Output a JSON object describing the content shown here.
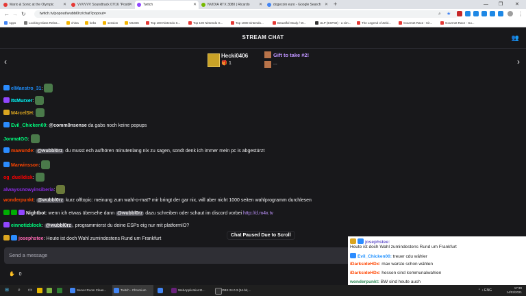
{
  "browser": {
    "tabs": [
      {
        "label": "Mario & Sonic at the Olympic",
        "color": "#e53935"
      },
      {
        "label": "VVVVVV Soundtrack 07/16 \"Positi",
        "color": "#e53935"
      },
      {
        "label": "Twitch",
        "color": "#9146ff"
      },
      {
        "label": "NVIDIA RTX 3080 | Ricardo",
        "color": "#76b900"
      },
      {
        "label": "dogecoin euro - Google Search",
        "color": "#4285f4"
      }
    ],
    "url": "twitch.tv/popout/wubbl0rz/chat?popout=",
    "bookmarks": [
      {
        "label": "Apps",
        "color": "#4285f4"
      },
      {
        "label": "Looking Glass Relea...",
        "color": "#777"
      },
      {
        "label": "china",
        "color": "#f4b400"
      },
      {
        "label": "keks",
        "color": "#f4b400"
      },
      {
        "label": "session",
        "color": "#f4b400"
      },
      {
        "label": "MUSIK",
        "color": "#f4b400"
      },
      {
        "label": "Top 100 Nintendo S...",
        "color": "#e53935"
      },
      {
        "label": "Top 100 Nintendo S...",
        "color": "#e53935"
      },
      {
        "label": "Top 1000 nintendo...",
        "color": "#e53935"
      },
      {
        "label": "Beautiful Study / W...",
        "color": "#e53935"
      },
      {
        "label": "ULP (ESP32) - a sim...",
        "color": "#333"
      },
      {
        "label": "The Legend of Zeld...",
        "color": "#e53935"
      },
      {
        "label": "Gourmet Race - Kir...",
        "color": "#e53935"
      },
      {
        "label": "Gourmet Race - Su...",
        "color": "#e53935"
      }
    ]
  },
  "chat": {
    "header_title": "STREAM CHAT",
    "gift_user": "Hecki0406",
    "gift_count": "1",
    "gift_cta": "Gift to take #2!",
    "gift_more": "...",
    "paused_label": "Chat Paused Due to Scroll",
    "input_placeholder": "Send a message",
    "points": "0",
    "messages": [
      {
        "user": "elMaestro_31",
        "color": "#1e90ff",
        "text": "",
        "mention": "",
        "after": "",
        "link": "",
        "emote": true,
        "badge": "#2b8cff"
      },
      {
        "user": "ItsMurxer",
        "color": "#00ffff",
        "text": "",
        "mention": "",
        "after": "",
        "link": "",
        "emote": true,
        "badge": "#9146ff"
      },
      {
        "user": "M4rcelSH",
        "color": "#daa520",
        "text": "",
        "mention": "",
        "after": "",
        "link": "",
        "emote": true,
        "badge": "#daa520"
      },
      {
        "user": "Evil_Chicken00",
        "color": "#00ff7f",
        "text": "",
        "mention": "@comm0nsense",
        "after": " da gabs noch keine popups",
        "link": "",
        "emote": false,
        "badge": "#2b8cff"
      },
      {
        "user": "JonmatGG",
        "color": "#00ff7f",
        "text": "",
        "mention": "",
        "after": "",
        "link": "",
        "emote": true,
        "badge": ""
      },
      {
        "user": "mawunde",
        "color": "#ff4500",
        "text": " ",
        "mention": "@wubbl0rz",
        "after": " du musst ech aufhören minutenlang nix zu sagen, sondt denk ich immer mein pc is abgestürzt",
        "link": "",
        "emote": false,
        "badge": "#2b8cff"
      },
      {
        "user": "Marwinsson",
        "color": "#ff4500",
        "text": "",
        "mention": "",
        "after": "",
        "link": "",
        "emote": true,
        "badge": "#2b8cff"
      },
      {
        "user": "og_duelldisk",
        "color": "#ff0000",
        "text": "",
        "mention": "",
        "after": "",
        "link": "",
        "emote": true,
        "badge": ""
      },
      {
        "user": "alwayssnowyinsiberia",
        "color": "#8a2be2",
        "text": "",
        "mention": "",
        "after": "",
        "link": "",
        "emote": true,
        "badge": ""
      },
      {
        "user": "wonderpunkt",
        "color": "#ff4500",
        "text": " ",
        "mention": "@wubbl0rz",
        "after": " kurz offtopic: meinung zum wahl-o-mat? mir bringt der gar nix, will aber nicht 1000 seiten wahlprogramm durchlesen",
        "link": "",
        "emote": false,
        "badge": ""
      },
      {
        "user": "Nightbot",
        "color": "#efeff1",
        "text": " wenn ich etwas übersehe dann ",
        "mention": "@wubbl0rz",
        "after": " dazu schreiben oder schaut im discord vorbei ",
        "link": "http://d.m4x.tv",
        "emote": false,
        "badge": "#00ad03"
      },
      {
        "user": "einnotizblock",
        "color": "#00ff7f",
        "text": " ",
        "mention": "@wubbl0rz",
        "after": ", programmierst du deine ESPs eig nur mit platformIO?",
        "link": "",
        "emote": false,
        "badge": "#9146ff"
      },
      {
        "user": "josephstee",
        "color": "#ff69b4",
        "text": " Heute ist doch Wahl zumindestens Rund um Frankfurt",
        "mention": "",
        "after": "",
        "link": "",
        "emote": false,
        "badge": "#daa520"
      }
    ]
  },
  "overlay": {
    "lines": [
      {
        "user": "josephstee:",
        "color": "#6a5acd",
        "text": ""
      },
      {
        "user": "",
        "color": "#222",
        "text": "Heute ist doch Wahl zumindestens Rund um Frankfurt"
      },
      {
        "user": "Evil_Chicken00:",
        "color": "#1e90ff",
        "text": " treuer cdu wähler"
      },
      {
        "user": "iDarksideHDx:",
        "color": "#ff4500",
        "text": " max warste schon wählen"
      },
      {
        "user": "iDarksideHDx:",
        "color": "#ff4500",
        "text": " hessen sind kommunalwahlen"
      },
      {
        "user": "wonderpunkt:",
        "color": "#2e8b57",
        "text": " BW sind heute auch"
      }
    ]
  },
  "taskbar": {
    "apps": [
      {
        "label": "Server Room Clean...",
        "color": "#4285f4"
      },
      {
        "label": "Twitch - Chromium",
        "color": "#4285f4"
      },
      {
        "label": "",
        "color": "#4285f4"
      },
      {
        "label": "WebApplication11...",
        "color": "#68217a"
      },
      {
        "label": "OBS 24.0.3 (64-bit,...",
        "color": "#333"
      }
    ],
    "lang": "ENG",
    "time": "17:30",
    "date": "14/03/2021"
  }
}
